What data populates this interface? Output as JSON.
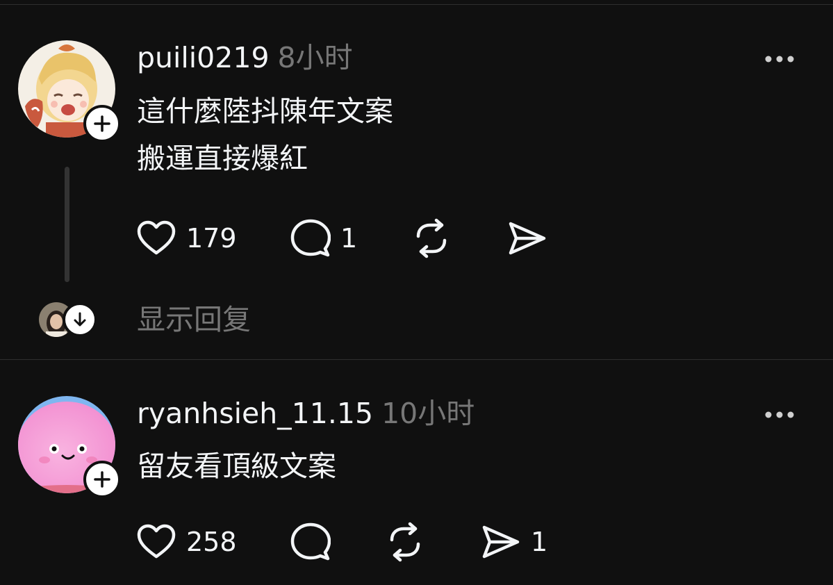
{
  "posts": [
    {
      "username": "puili0219",
      "timestamp": "8小时",
      "lines": [
        "這什麼陸抖陳年文案",
        "搬運直接爆紅"
      ],
      "likes": "179",
      "replies": "1",
      "reposts": "",
      "shares": "",
      "show_replies_label": "显示回复"
    },
    {
      "username": "ryanhsieh_11.15",
      "timestamp": "10小时",
      "lines": [
        "留友看頂級文案"
      ],
      "likes": "258",
      "replies": "",
      "reposts": "",
      "shares": "1"
    }
  ],
  "icons": {
    "like": "heart-icon",
    "reply": "speech-bubble-icon",
    "repost": "repost-arrows-icon",
    "share": "paper-plane-icon",
    "follow": "plus-icon",
    "expand": "arrow-down-icon",
    "more": "more-dots-icon"
  },
  "colors": {
    "background": "#101010",
    "text": "#f3f5f7",
    "secondary": "#777777",
    "divider": "#2f2f2f",
    "badge": "#ffffff"
  }
}
